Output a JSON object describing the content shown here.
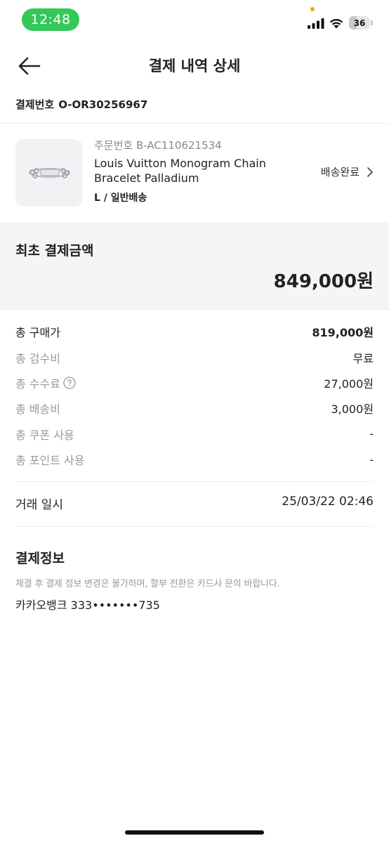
{
  "status_bar": {
    "time": "12:48",
    "battery": "36",
    "battery_percent": 36
  },
  "header": {
    "title": "결제 내역 상세",
    "back_icon": "arrow-left-icon"
  },
  "payment_number": {
    "label": "결제번호",
    "value": "O-OR30256967"
  },
  "product": {
    "order_number": "주문번호 B-AC110621534",
    "name_line1": "Louis Vuitton Monogram Chain",
    "name_line2": "Bracelet Palladium",
    "option": "L / 일반배송",
    "status": "배송완료",
    "status_icon": "chevron-right-icon"
  },
  "initial_payment": {
    "label": "최초 결제금액",
    "amount": "849,000원"
  },
  "breakdown": [
    {
      "label": "총 구매가",
      "value": "819,000원"
    },
    {
      "label": "총 검수비",
      "value": "무료"
    },
    {
      "label": "총 수수료",
      "value": "27,000원"
    },
    {
      "label": "총 배송비",
      "value": "3,000원"
    },
    {
      "label": "총 쿠폰 사용",
      "value": "-"
    },
    {
      "label": "총 포인트 사용",
      "value": "-"
    }
  ],
  "transaction_date": {
    "label": "거래 일시",
    "value": "25/03/22 02:46"
  },
  "payment_info": {
    "title": "결제정보",
    "notice": "체결 후 결제 정보 변경은 불가하며, 할부 전환은 카드사 문의 바랍니다.",
    "method": "카카오뱅크 333•••••••735"
  },
  "colors": {
    "status_pill": "#34c759",
    "accent_text": "#222222",
    "muted_text": "#9a9a9a"
  }
}
